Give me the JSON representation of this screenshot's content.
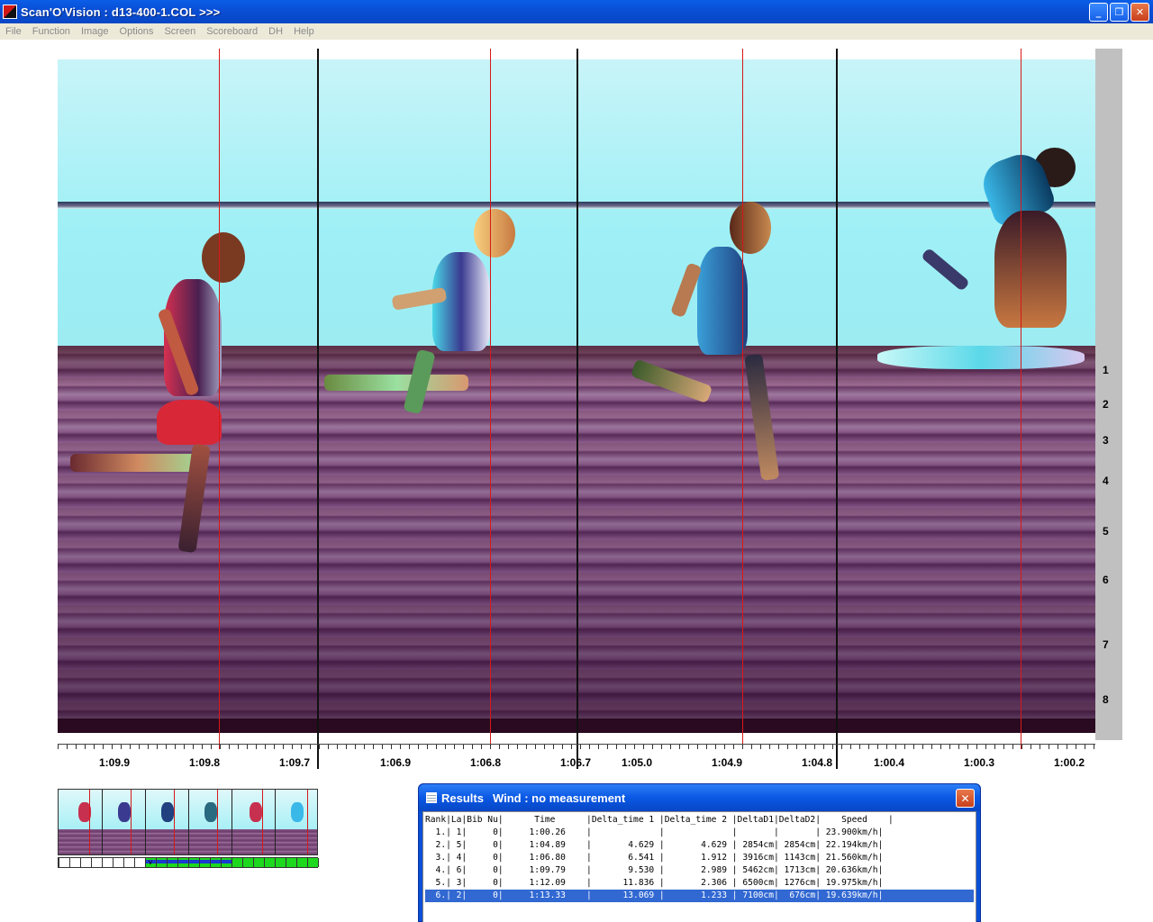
{
  "window": {
    "title": "Scan'O'Vision :  d13-400-1.COL  >>>",
    "minimize": "_",
    "restore": "❐",
    "close": "✕"
  },
  "menu": [
    "File",
    "Function",
    "Image",
    "Options",
    "Screen",
    "Scoreboard",
    "DH",
    "Help"
  ],
  "lanes": [
    "1",
    "2",
    "3",
    "4",
    "5",
    "6",
    "7",
    "8"
  ],
  "time_labels": [
    "1:09.9",
    "1:09.8",
    "1:09.7",
    "1:06.9",
    "1:06.8",
    "1:06.7",
    "1:05.0",
    "1:04.9",
    "1:04.8",
    "1:00.4",
    "1:00.3",
    "1:00.2"
  ],
  "results": {
    "title": "Results",
    "wind": "Wind : no measurement",
    "close": "✕",
    "header": "Rank|La|Bib Nu|      Time      |Delta_time 1 |Delta_time 2 |DeltaD1|DeltaD2|    Speed    |",
    "rows": [
      "  1.| 1|     0|     1:00.26    |             |             |       |       | 23.900km/h|",
      "  2.| 5|     0|     1:04.89    |       4.629 |       4.629 | 2854cm| 2854cm| 22.194km/h|",
      "  3.| 4|     0|     1:06.80    |       6.541 |       1.912 | 3916cm| 1143cm| 21.560km/h|",
      "  4.| 6|     0|     1:09.79    |       9.530 |       2.989 | 5462cm| 1713cm| 20.636km/h|",
      "  5.| 3|     0|     1:12.09    |      11.836 |       2.306 | 6500cm| 1276cm| 19.975km/h|",
      "  6.| 2|     0|     1:13.33    |      13.069 |       1.233 | 7100cm|  676cm| 19.639km/h|"
    ],
    "selected_row": 5
  },
  "thumbnail": {
    "marker": "v"
  },
  "colors": {
    "titlebar": "#0a4fd6",
    "cursor_line": "#d81818",
    "selected_row": "#3168d2",
    "progress_green": "#1ed81e",
    "progress_blue": "#1a3ad0"
  }
}
